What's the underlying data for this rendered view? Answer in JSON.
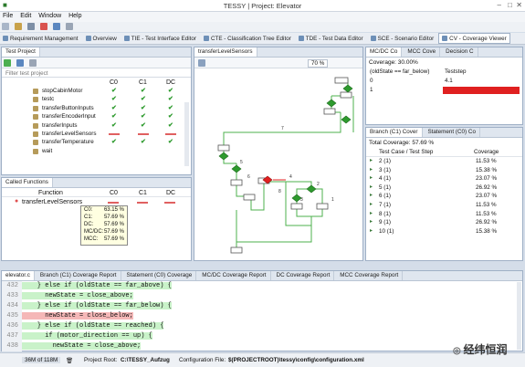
{
  "app": {
    "title": "TESSY | Project: Elevator"
  },
  "menu": [
    "File",
    "Edit",
    "Window",
    "Help"
  ],
  "perspectives": [
    {
      "label": "Requirement Management",
      "active": false
    },
    {
      "label": "Overview",
      "active": false
    },
    {
      "label": "TIE - Test Interface Editor",
      "active": false
    },
    {
      "label": "CTE - Classification Tree Editor",
      "active": false
    },
    {
      "label": "TDE - Test Data Editor",
      "active": false
    },
    {
      "label": "SCE - Scenario Editor",
      "active": false
    },
    {
      "label": "CV - Coverage Viewer",
      "active": true
    }
  ],
  "test_project": {
    "tab": "Test Project",
    "filter_placeholder": "Filter test project",
    "columns": [
      "C0",
      "C1",
      "DC"
    ],
    "rows": [
      {
        "name": "stopCabinMotor",
        "c0": "ok",
        "c1": "ok",
        "dc": "ok"
      },
      {
        "name": "testc",
        "c0": "ok",
        "c1": "ok",
        "dc": "ok"
      },
      {
        "name": "transferButtonInputs",
        "c0": "ok",
        "c1": "ok",
        "dc": "ok"
      },
      {
        "name": "transferEncoderInput",
        "c0": "ok",
        "c1": "ok",
        "dc": "ok"
      },
      {
        "name": "transferInputs",
        "c0": "ok",
        "c1": "ok",
        "dc": "ok"
      },
      {
        "name": "transferLevelSensors",
        "c0": "bar",
        "c1": "bar",
        "dc": "bar"
      },
      {
        "name": "transferTemperature",
        "c0": "ok",
        "c1": "ok",
        "dc": "ok"
      },
      {
        "name": "wait",
        "c0": "",
        "c1": "",
        "dc": ""
      }
    ]
  },
  "called_functions": {
    "tab": "Called Functions",
    "columns": [
      "Function",
      "C0",
      "C1",
      "DC"
    ],
    "row": {
      "name": "transferLevelSensors"
    },
    "tooltip": [
      {
        "k": "C0:",
        "v": "63.15 %"
      },
      {
        "k": "C1:",
        "v": "57.69 %"
      },
      {
        "k": "DC:",
        "v": "57.69 %"
      },
      {
        "k": "MC/DC:",
        "v": "57.69 %"
      },
      {
        "k": "MCC:",
        "v": "57.69 %"
      }
    ]
  },
  "flow": {
    "tab": "transferLevelSensors",
    "zoom": "70 %",
    "edge_labels": [
      "7",
      "5",
      "6",
      "8",
      "4",
      "3",
      "2",
      "1"
    ]
  },
  "mcdc": {
    "tabs": [
      "MC/DC Co",
      "MCC Cove",
      "Decision C"
    ],
    "coverage": "Coverage: 30.00%",
    "col_condition": "(oldState == far_below)",
    "col_teststep": "Teststep",
    "rows": [
      {
        "cond": "0",
        "step": "4.1",
        "red": false
      },
      {
        "cond": "1",
        "step": "",
        "red": true
      }
    ]
  },
  "branch": {
    "tabs": [
      "Branch (C1) Cover",
      "Statement (C0) Co"
    ],
    "total": "Total Coverage: 57.69 %",
    "columns": [
      "Test Case / Test Step",
      "Coverage"
    ],
    "rows": [
      {
        "name": "2 (1)",
        "cov": "11.53 %"
      },
      {
        "name": "3 (1)",
        "cov": "15.38 %"
      },
      {
        "name": "4 (1)",
        "cov": "23.07 %"
      },
      {
        "name": "5 (1)",
        "cov": "26.92 %"
      },
      {
        "name": "6 (1)",
        "cov": "23.07 %"
      },
      {
        "name": "7 (1)",
        "cov": "11.53 %"
      },
      {
        "name": "8 (1)",
        "cov": "11.53 %"
      },
      {
        "name": "9 (1)",
        "cov": "26.92 %"
      },
      {
        "name": "10 (1)",
        "cov": "15.38 %"
      }
    ]
  },
  "editor": {
    "tabs": [
      "elevator.c",
      "Branch (C1) Coverage Report",
      "Statement (C0) Coverage",
      "MC/DC Coverage Report",
      "DC Coverage Report",
      "MCC Coverage Report"
    ],
    "lines": [
      {
        "n": "432",
        "text": "    } else if (oldState == far_above) {",
        "bg": "green"
      },
      {
        "n": "433",
        "text": "      newState = close_above;",
        "bg": "green"
      },
      {
        "n": "434",
        "text": "    } else if (oldState == far_below) {",
        "bg": "green"
      },
      {
        "n": "435",
        "text": "      newState = close_below;",
        "bg": "red"
      },
      {
        "n": "436",
        "text": "    } else if (oldState == reached) {",
        "bg": "green"
      },
      {
        "n": "437",
        "text": "      if (motor_direction == up) {",
        "bg": "green"
      },
      {
        "n": "438",
        "text": "        newState = close_above;",
        "bg": "green"
      }
    ]
  },
  "status": {
    "memory": "36M of 118M",
    "project_root_label": "Project Root:",
    "project_root": "C:\\TESSY_Aufzug",
    "config_label": "Configuration File:",
    "config": "$(PROJECTROOT)\\tessy\\config\\configuration.xml"
  },
  "watermark": "经纬恒润",
  "colors": {
    "covered": "#c9f2c9",
    "uncovered": "#f5b7b7",
    "ok": "#2d9a2d",
    "accent": "#e02020"
  }
}
